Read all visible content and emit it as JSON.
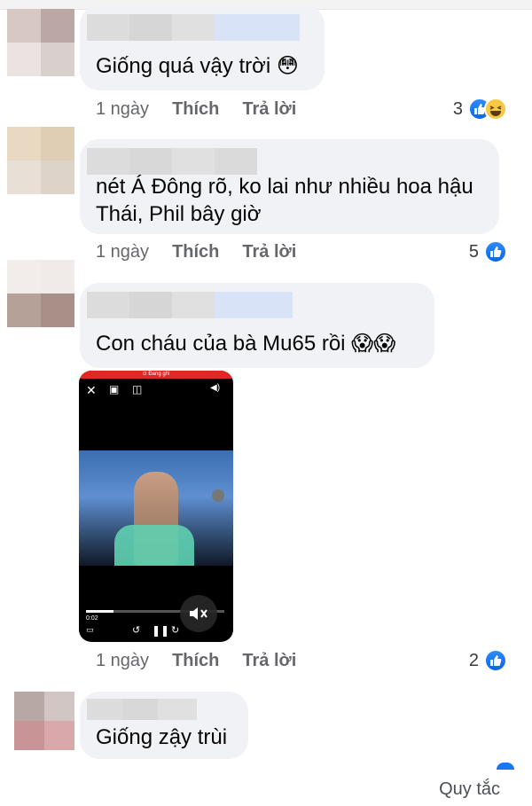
{
  "comments": [
    {
      "text_lines": [
        "Giống quá vậy trời 😳"
      ],
      "time": "1 ngày",
      "like_label": "Thích",
      "reply_label": "Trả lời",
      "reaction_count": "3",
      "reactions": [
        "like-icon",
        "haha-icon"
      ]
    },
    {
      "text_lines": [
        "nét Á Đông rõ, ko lai như nhiều hoa hậu",
        "Thái, Phil bây giờ"
      ],
      "time": "1 ngày",
      "like_label": "Thích",
      "reply_label": "Trả lời",
      "reaction_count": "5",
      "reactions": [
        "like-icon"
      ]
    },
    {
      "text_lines": [
        "Con cháu của bà Mu65 rồi 😱😱"
      ],
      "time": "1 ngày",
      "like_label": "Thích",
      "reply_label": "Trả lời",
      "reaction_count": "2",
      "reactions": [
        "like-icon"
      ]
    },
    {
      "text_lines": [
        "Giống zậy trùi"
      ]
    }
  ],
  "video": {
    "recording_label": "⊙ Đang ghi",
    "elapsed": "0:02",
    "progress_fraction": 0.2,
    "muted": true
  },
  "footer": {
    "rules_label": "Quy tắc"
  },
  "colors": {
    "bubble": "#f0f2f5",
    "meta_text": "#65676b",
    "like_blue": "#1877f2",
    "haha_yellow": "#f7c843",
    "recording_red": "#e02a20"
  }
}
